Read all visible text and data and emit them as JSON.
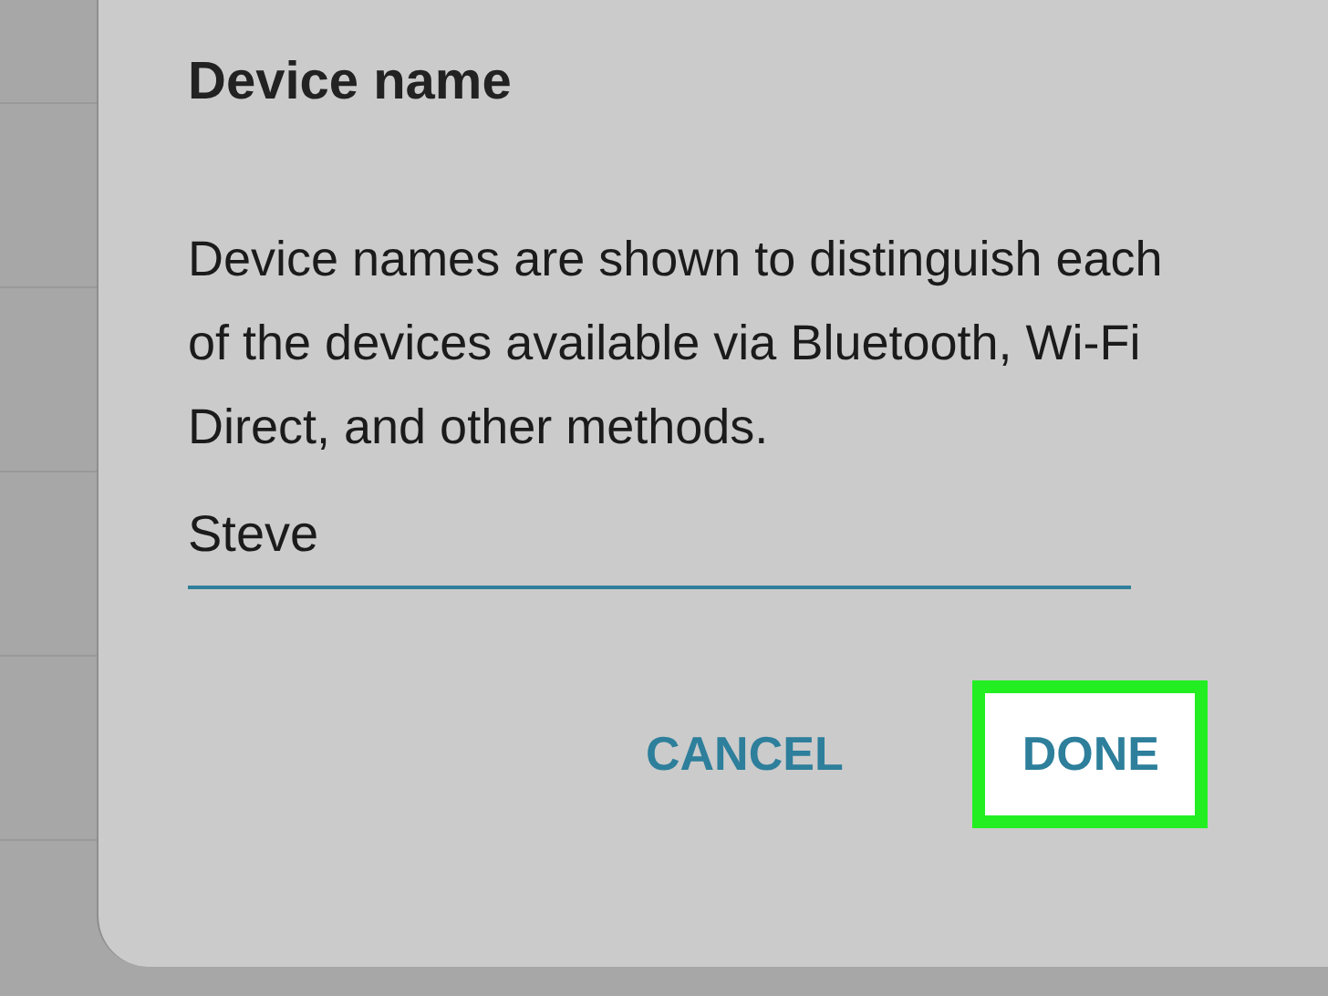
{
  "dialog": {
    "title": "Device name",
    "message": "Device names are shown to distinguish each of the devices available via Bluetooth, Wi-Fi Direct, and other methods.",
    "field": {
      "value": "Steve"
    },
    "buttons": [
      {
        "label": "CANCEL",
        "highlighted": false
      },
      {
        "label": "DONE",
        "highlighted": true
      }
    ]
  }
}
